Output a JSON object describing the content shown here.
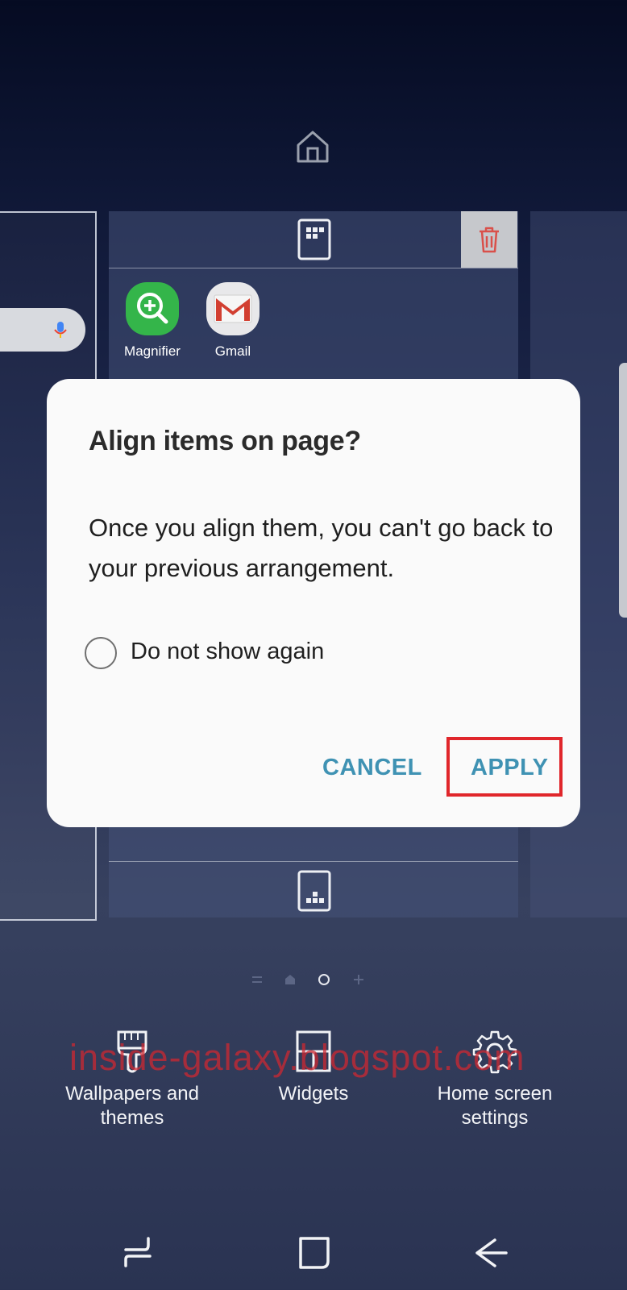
{
  "dialog": {
    "title": "Align items on page?",
    "message": "Once you align them, you can't go back to your previous arrangement.",
    "checkbox_label": "Do not show again",
    "cancel_label": "CANCEL",
    "apply_label": "APPLY"
  },
  "apps": [
    {
      "label": "Magnifier",
      "icon": "magnifier-icon"
    },
    {
      "label": "Gmail",
      "icon": "gmail-icon"
    }
  ],
  "bottom_options": {
    "wallpapers": "Wallpapers and themes",
    "widgets": "Widgets",
    "home_settings": "Home screen settings"
  },
  "watermark": "inside-galaxy.blogspot.com",
  "colors": {
    "accent": "#3f92b3",
    "highlight": "#e0262b",
    "watermark": "#cd2832"
  }
}
